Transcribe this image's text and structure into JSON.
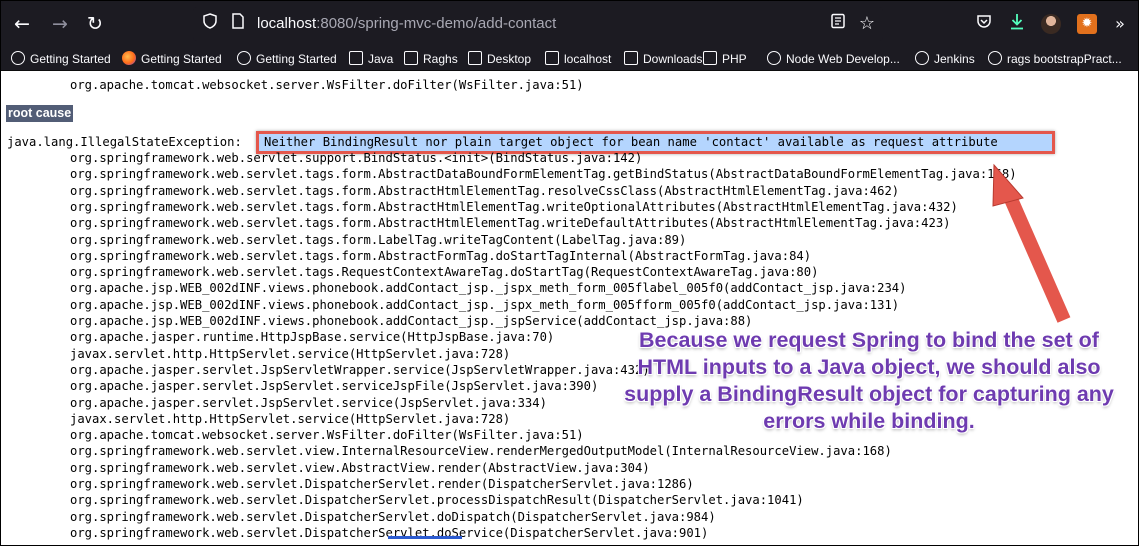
{
  "browser": {
    "url_host": "localhost",
    "url_rest": ":8080/spring-mvc-demo/add-contact",
    "icons": [
      "back-icon",
      "forward-icon",
      "reload-icon",
      "shield-icon",
      "page-icon",
      "reader-view-icon",
      "bookmark-star-icon",
      "pocket-icon",
      "downloads-icon",
      "profile-avatar",
      "extension-icon"
    ]
  },
  "bookmarks": [
    {
      "label": "Getting Started",
      "icon": "globe"
    },
    {
      "label": "Getting Started",
      "icon": "firefox"
    },
    {
      "label": "Getting Started",
      "icon": "globe"
    },
    {
      "label": "Java",
      "icon": "folder"
    },
    {
      "label": "Raghs",
      "icon": "folder"
    },
    {
      "label": "Desktop",
      "icon": "folder"
    },
    {
      "label": "localhost",
      "icon": "folder"
    },
    {
      "label": "Downloads",
      "icon": "folder"
    },
    {
      "label": "PHP",
      "icon": "folder"
    },
    {
      "label": "Node Web Develop...",
      "icon": "globe"
    },
    {
      "label": "Jenkins",
      "icon": "globe"
    },
    {
      "label": "rags bootstrapPract...",
      "icon": "globe"
    }
  ],
  "page": {
    "top_line": "org.apache.tomcat.websocket.server.WsFilter.doFilter(WsFilter.java:51)",
    "root_cause_label": "root cause",
    "exception_class": "java.lang.IllegalStateException:",
    "exception_message": "Neither BindingResult nor plain target object for bean name 'contact' available as request attribute",
    "stack": [
      "org.springframework.web.servlet.support.BindStatus.<init>(BindStatus.java:142)",
      "org.springframework.web.servlet.tags.form.AbstractDataBoundFormElementTag.getBindStatus(AbstractDataBoundFormElementTag.java:168)",
      "org.springframework.web.servlet.tags.form.AbstractHtmlElementTag.resolveCssClass(AbstractHtmlElementTag.java:462)",
      "org.springframework.web.servlet.tags.form.AbstractHtmlElementTag.writeOptionalAttributes(AbstractHtmlElementTag.java:432)",
      "org.springframework.web.servlet.tags.form.AbstractHtmlElementTag.writeDefaultAttributes(AbstractHtmlElementTag.java:423)",
      "org.springframework.web.servlet.tags.form.LabelTag.writeTagContent(LabelTag.java:89)",
      "org.springframework.web.servlet.tags.form.AbstractFormTag.doStartTagInternal(AbstractFormTag.java:84)",
      "org.springframework.web.servlet.tags.RequestContextAwareTag.doStartTag(RequestContextAwareTag.java:80)",
      "org.apache.jsp.WEB_002dINF.views.phonebook.addContact_jsp._jspx_meth_form_005flabel_005f0(addContact_jsp.java:234)",
      "org.apache.jsp.WEB_002dINF.views.phonebook.addContact_jsp._jspx_meth_form_005fform_005f0(addContact_jsp.java:131)",
      "org.apache.jsp.WEB_002dINF.views.phonebook.addContact_jsp._jspService(addContact_jsp.java:88)",
      "org.apache.jasper.runtime.HttpJspBase.service(HttpJspBase.java:70)",
      "javax.servlet.http.HttpServlet.service(HttpServlet.java:728)",
      "org.apache.jasper.servlet.JspServletWrapper.service(JspServletWrapper.java:432)",
      "org.apache.jasper.servlet.JspServlet.serviceJspFile(JspServlet.java:390)",
      "org.apache.jasper.servlet.JspServlet.service(JspServlet.java:334)",
      "javax.servlet.http.HttpServlet.service(HttpServlet.java:728)",
      "org.apache.tomcat.websocket.server.WsFilter.doFilter(WsFilter.java:51)",
      "org.springframework.web.servlet.view.InternalResourceView.renderMergedOutputModel(InternalResourceView.java:168)",
      "org.springframework.web.servlet.view.AbstractView.render(AbstractView.java:304)",
      "org.springframework.web.servlet.DispatcherServlet.render(DispatcherServlet.java:1286)",
      "org.springframework.web.servlet.DispatcherServlet.processDispatchResult(DispatcherServlet.java:1041)",
      "org.springframework.web.servlet.DispatcherServlet.doDispatch(DispatcherServlet.java:984)",
      "org.springframework.web.servlet.DispatcherServlet.doService(DispatcherServlet.java:901)"
    ]
  },
  "annotation": {
    "text": "Because we request Spring to bind the set of HTML inputs to a Java object, we should also supply a BindingResult object for capturing any errors while binding.",
    "color": "#6e3bb0",
    "highlight_border_color": "#e4574c",
    "arrow_color": "#e4574c"
  }
}
